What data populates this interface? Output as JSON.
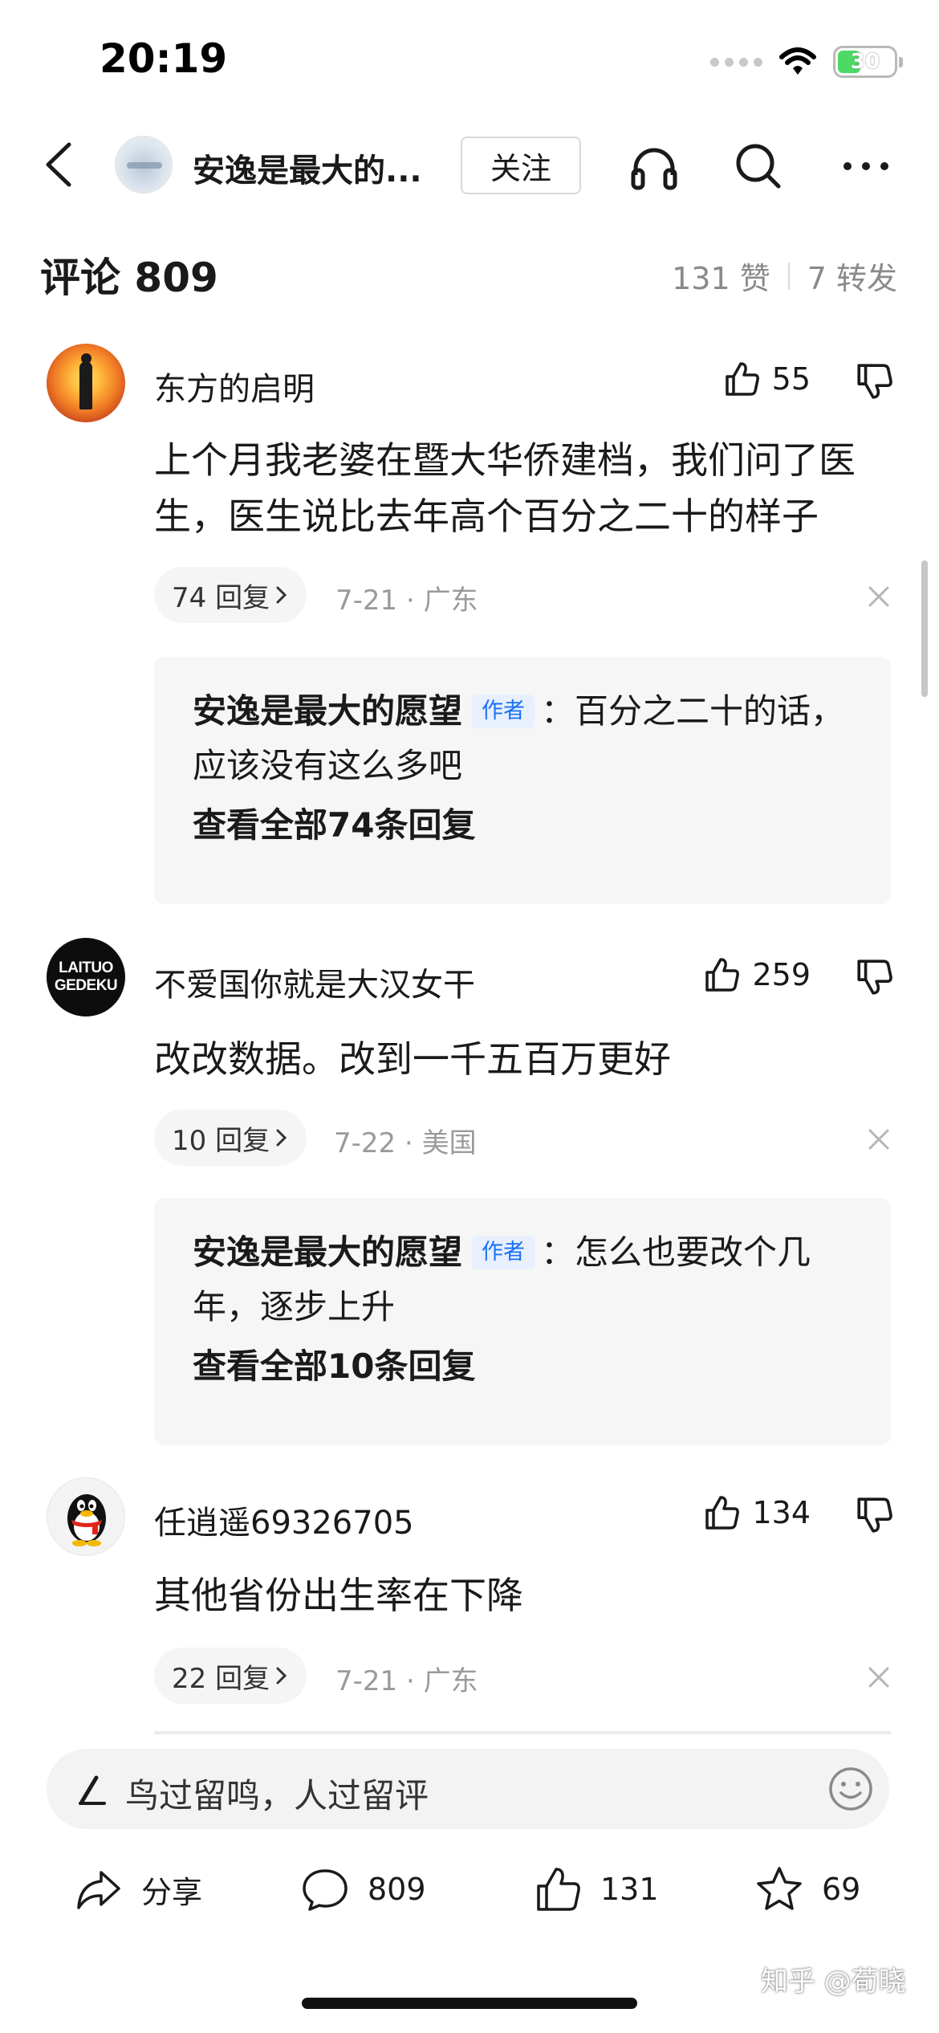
{
  "status_bar": {
    "time": "20:19",
    "battery": "30"
  },
  "nav": {
    "title": "安逸是最大的...",
    "follow_label": "关注"
  },
  "comments_header": {
    "title": "评论 809",
    "likes": "131 赞",
    "reposts": "7 转发"
  },
  "comments": [
    {
      "username": "东方的启明",
      "likes": "55",
      "text": "上个月我老婆在暨大华侨建档，我们问了医生，医生说比去年高个百分之二十的样子",
      "replies_label": "74 回复",
      "meta": "7-21 · 广东",
      "top_reply": {
        "author": "安逸是最大的愿望",
        "badge": "作者",
        "text": "：百分之二十的话，应该没有这么多吧",
        "view_all": "查看全部74条回复"
      }
    },
    {
      "username": "不爱国你就是大汉女干",
      "avatar_text": [
        "LAITUO",
        "GEDEKU"
      ],
      "likes": "259",
      "text": "改改数据。改到一千五百万更好",
      "replies_label": "10 回复",
      "meta": "7-22 · 美国",
      "top_reply": {
        "author": "安逸是最大的愿望",
        "badge": "作者",
        "text": "：怎么也要改个几年，逐步上升",
        "view_all": "查看全部10条回复"
      }
    },
    {
      "username": "任逍遥69326705",
      "likes": "134",
      "text": "其他省份出生率在下降",
      "replies_label": "22 回复",
      "meta": "7-21 · 广东"
    }
  ],
  "composer": {
    "placeholder": "鸟过留鸣，人过留评"
  },
  "actions": {
    "share": "分享",
    "comments": "809",
    "likes": "131",
    "favorites": "69"
  },
  "watermark": "知乎 @荀晓",
  "colors": {
    "accent": "#1772f6",
    "muted": "#9a9a9a",
    "panel": "#f6f6f6"
  },
  "icons": [
    "back-icon",
    "headphones-icon",
    "search-icon",
    "more-icon",
    "thumbs-up-icon",
    "thumbs-down-icon",
    "chevron-right-icon",
    "close-icon",
    "pen-icon",
    "emoji-icon",
    "share-icon",
    "comment-icon",
    "star-icon",
    "wifi-icon"
  ]
}
